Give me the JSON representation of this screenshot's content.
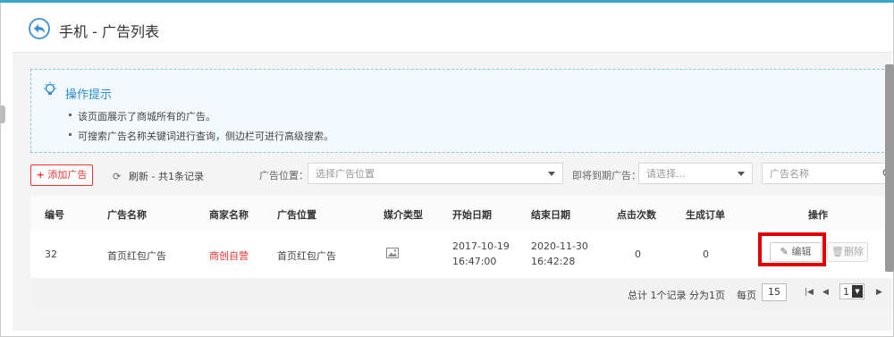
{
  "header": {
    "title": "手机 - 广告列表"
  },
  "tips": {
    "title": "操作提示",
    "items": [
      "该页面展示了商城所有的广告。",
      "可搜索广告名称关键词进行查询，侧边栏可进行高级搜索。"
    ]
  },
  "toolbar": {
    "add_label": "添加广告",
    "refresh_label": "刷新 - 共1条记录",
    "position_label": "广告位置：",
    "position_placeholder": "选择广告位置",
    "expire_label": "即将到期广告：",
    "expire_placeholder": "请选择...",
    "search_placeholder": "广告名称"
  },
  "table": {
    "columns": [
      "编号",
      "广告名称",
      "商家名称",
      "广告位置",
      "媒介类型",
      "开始日期",
      "结束日期",
      "点击次数",
      "生成订单",
      "操作"
    ],
    "rows": [
      {
        "id": "32",
        "name": "首页红包广告",
        "merchant": "商创自营",
        "position": "首页红包广告",
        "media": "image-icon",
        "start_date": "2017-10-19",
        "start_time": "16:47:00",
        "end_date": "2020-11-30",
        "end_time": "16:42:28",
        "clicks": "0",
        "orders": "0",
        "edit_label": "编辑",
        "delete_label": "删除"
      }
    ]
  },
  "pager": {
    "summary": "总计 1个记录 分为1页",
    "per_page_label": "每页",
    "per_page_value": "15",
    "current_page": "1"
  },
  "colors": {
    "accent": "#2b8ed6",
    "danger": "#e33333",
    "highlight": "#e00000"
  }
}
